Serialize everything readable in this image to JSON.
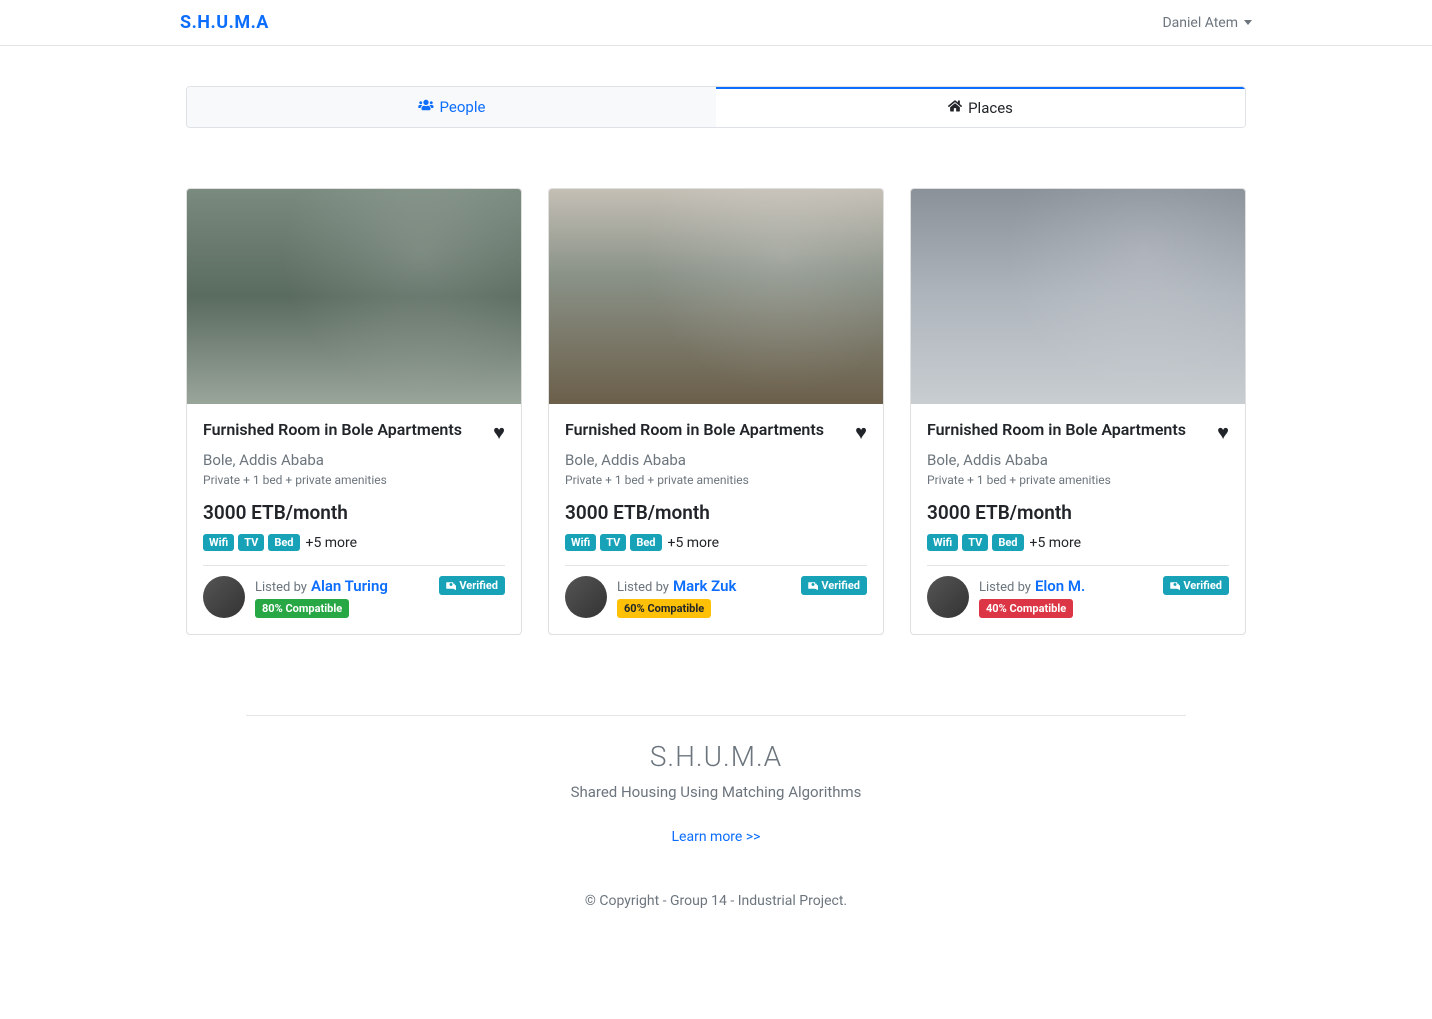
{
  "brand": "S.H.U.M.A",
  "user": {
    "name": "Daniel Atem"
  },
  "tabs": {
    "people": {
      "label": "People"
    },
    "places": {
      "label": "Places"
    }
  },
  "listings": [
    {
      "title": "Furnished Room in Bole Apartments",
      "location": "Bole, Addis Ababa",
      "meta": "Private + 1 bed + private amenities",
      "price": "3000 ETB/month",
      "amenities": [
        "Wifi",
        "TV",
        "Bed"
      ],
      "more_amenities": "+5 more",
      "listed_by_prefix": "Listed by",
      "lister": "Alan Turing",
      "compat": "80% Compatible",
      "compat_color": "green",
      "verified": "Verified"
    },
    {
      "title": "Furnished Room in Bole Apartments",
      "location": "Bole, Addis Ababa",
      "meta": "Private + 1 bed + private amenities",
      "price": "3000 ETB/month",
      "amenities": [
        "Wifi",
        "TV",
        "Bed"
      ],
      "more_amenities": "+5 more",
      "listed_by_prefix": "Listed by",
      "lister": "Mark Zuk",
      "compat": "60% Compatible",
      "compat_color": "yellow",
      "verified": "Verified"
    },
    {
      "title": "Furnished Room in Bole Apartments",
      "location": "Bole, Addis Ababa",
      "meta": "Private + 1 bed + private amenities",
      "price": "3000 ETB/month",
      "amenities": [
        "Wifi",
        "TV",
        "Bed"
      ],
      "more_amenities": "+5 more",
      "listed_by_prefix": "Listed by",
      "lister": "Elon M.",
      "compat": "40% Compatible",
      "compat_color": "red",
      "verified": "Verified"
    }
  ],
  "footer": {
    "title": "S.H.U.M.A",
    "subtitle": "Shared Housing Using Matching Algorithms",
    "learn_more": "Learn more >>",
    "copyright": "© Copyright - Group 14 - Industrial Project."
  }
}
